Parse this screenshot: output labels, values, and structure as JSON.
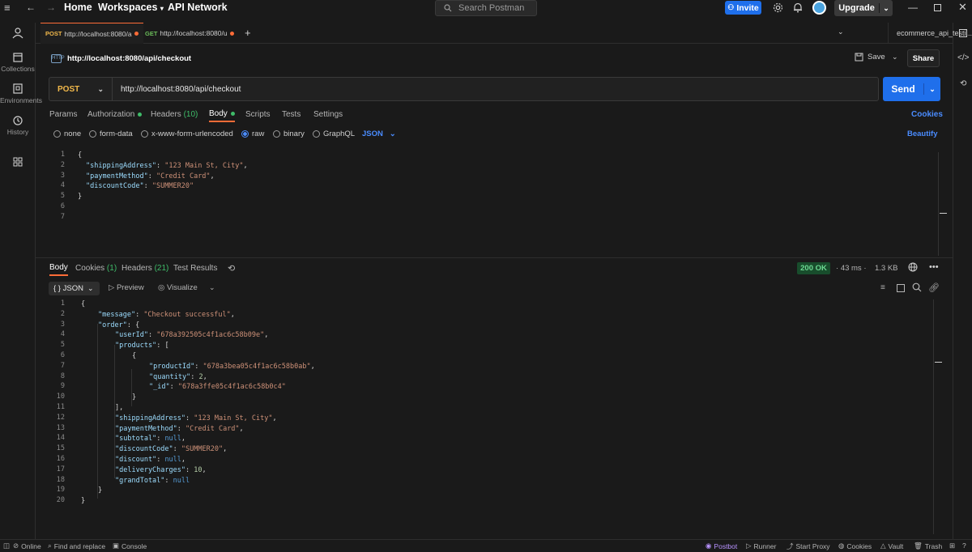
{
  "topbar": {
    "home": "Home",
    "workspaces": "Workspaces",
    "api_network": "API Network",
    "search_placeholder": "Search Postman",
    "invite": "Invite",
    "upgrade": "Upgrade"
  },
  "sidebar": {
    "items": [
      {
        "label": "Collections"
      },
      {
        "label": "Environments"
      },
      {
        "label": "History"
      }
    ]
  },
  "tabs": [
    {
      "method": "POST",
      "url": "http://localhost:8080/a"
    },
    {
      "method": "GET",
      "url": "http://localhost:8080/u"
    }
  ],
  "environment": "ecommerce_api_testi...",
  "request": {
    "title": "http://localhost:8080/api/checkout",
    "method": "POST",
    "url": "http://localhost:8080/api/checkout",
    "save": "Save",
    "share": "Share",
    "send": "Send"
  },
  "request_tabs": {
    "params": "Params",
    "authorization": "Authorization",
    "headers": "Headers",
    "headers_count": "(10)",
    "body": "Body",
    "scripts": "Scripts",
    "tests": "Tests",
    "settings": "Settings",
    "cookies": "Cookies"
  },
  "body_types": {
    "none": "none",
    "form_data": "form-data",
    "urlencoded": "x-www-form-urlencoded",
    "raw": "raw",
    "binary": "binary",
    "graphql": "GraphQL",
    "json": "JSON",
    "beautify": "Beautify"
  },
  "request_body": [
    {
      "n": "1",
      "t": "{"
    },
    {
      "n": "2",
      "k": "\"shippingAddress\"",
      "v": "\"123 Main St, City\"",
      "vt": "s",
      "c": ","
    },
    {
      "n": "3",
      "k": "\"paymentMethod\"",
      "v": "\"Credit Card\"",
      "vt": "s",
      "c": ","
    },
    {
      "n": "4",
      "k": "\"discountCode\"",
      "v": "\"SUMMER20\"",
      "vt": "s",
      "c": ""
    },
    {
      "n": "5",
      "t": "}"
    },
    {
      "n": "6",
      "t": ""
    },
    {
      "n": "7",
      "t": ""
    }
  ],
  "response_tabs": {
    "body": "Body",
    "cookies": "Cookies",
    "cookies_count": "(1)",
    "headers": "Headers",
    "headers_count": "(21)",
    "test_results": "Test Results"
  },
  "response_meta": {
    "status": "200 OK",
    "time": "43 ms",
    "size": "1.3 KB"
  },
  "response_view": {
    "format": "{ } JSON",
    "preview": "Preview",
    "visualize": "Visualize"
  },
  "response_body": [
    {
      "n": "1",
      "i": 0,
      "t": "{"
    },
    {
      "n": "2",
      "i": 1,
      "k": "\"message\"",
      "v": "\"Checkout successful\"",
      "vt": "s",
      "c": ","
    },
    {
      "n": "3",
      "i": 1,
      "k": "\"order\"",
      "v": "{",
      "vt": "p",
      "c": ""
    },
    {
      "n": "4",
      "i": 2,
      "k": "\"userId\"",
      "v": "\"678a392505c4f1ac6c58b09e\"",
      "vt": "s",
      "c": ","
    },
    {
      "n": "5",
      "i": 2,
      "k": "\"products\"",
      "v": "[",
      "vt": "p",
      "c": ""
    },
    {
      "n": "6",
      "i": 3,
      "t": "{"
    },
    {
      "n": "7",
      "i": 4,
      "k": "\"productId\"",
      "v": "\"678a3bea05c4f1ac6c58b0ab\"",
      "vt": "s",
      "c": ","
    },
    {
      "n": "8",
      "i": 4,
      "k": "\"quantity\"",
      "v": "2",
      "vt": "n",
      "c": ","
    },
    {
      "n": "9",
      "i": 4,
      "k": "\"_id\"",
      "v": "\"678a3ffe05c4f1ac6c58b0c4\"",
      "vt": "s",
      "c": ""
    },
    {
      "n": "10",
      "i": 3,
      "t": "}"
    },
    {
      "n": "11",
      "i": 2,
      "t": "],"
    },
    {
      "n": "12",
      "i": 2,
      "k": "\"shippingAddress\"",
      "v": "\"123 Main St, City\"",
      "vt": "s",
      "c": ","
    },
    {
      "n": "13",
      "i": 2,
      "k": "\"paymentMethod\"",
      "v": "\"Credit Card\"",
      "vt": "s",
      "c": ","
    },
    {
      "n": "14",
      "i": 2,
      "k": "\"subtotal\"",
      "v": "null",
      "vt": "nl",
      "c": ","
    },
    {
      "n": "15",
      "i": 2,
      "k": "\"discountCode\"",
      "v": "\"SUMMER20\"",
      "vt": "s",
      "c": ","
    },
    {
      "n": "16",
      "i": 2,
      "k": "\"discount\"",
      "v": "null",
      "vt": "nl",
      "c": ","
    },
    {
      "n": "17",
      "i": 2,
      "k": "\"deliveryCharges\"",
      "v": "10",
      "vt": "n",
      "c": ","
    },
    {
      "n": "18",
      "i": 2,
      "k": "\"grandTotal\"",
      "v": "null",
      "vt": "nl",
      "c": ""
    },
    {
      "n": "19",
      "i": 1,
      "t": "}"
    },
    {
      "n": "20",
      "i": 0,
      "t": "}"
    }
  ],
  "statusbar": {
    "online": "Online",
    "find_replace": "Find and replace",
    "console": "Console",
    "postbot": "Postbot",
    "runner": "Runner",
    "start_proxy": "Start Proxy",
    "cookies": "Cookies",
    "vault": "Vault",
    "trash": "Trash"
  },
  "colors": {
    "accent": "#ff6c37",
    "primary": "#1f6feb",
    "success": "#3fbc69"
  }
}
